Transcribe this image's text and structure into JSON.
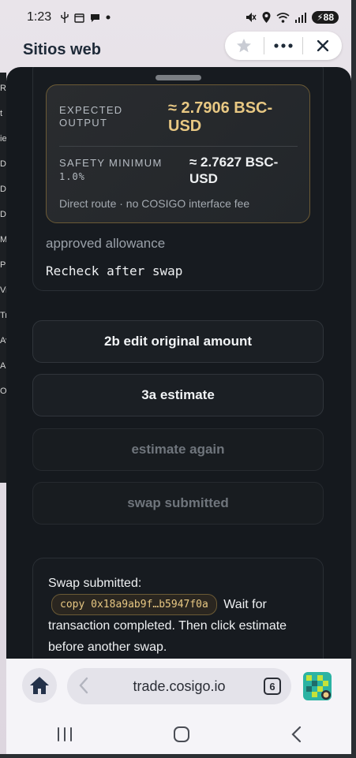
{
  "status_bar": {
    "time": "1:23",
    "battery": "88",
    "left_icons": [
      "usb-icon",
      "calendar-icon",
      "chat-icon",
      "dot-icon"
    ],
    "right_icons": [
      "mute-icon",
      "location-icon",
      "wifi-icon",
      "signal-icon"
    ]
  },
  "background_page": {
    "title": "Sitios web",
    "edge_letters": [
      "Re",
      "t",
      "ie",
      "Do",
      "Do",
      "Do",
      "M",
      "Pi",
      "Vi",
      "Tr",
      "Av",
      "A",
      "O"
    ]
  },
  "pill_actions": [
    "star-icon",
    "more-icon",
    "close-icon"
  ],
  "quote": {
    "expected_output_label": "EXPECTED OUTPUT",
    "expected_output_value": "≈ 2.7906 BSC-USD",
    "safety_minimum_label": "SAFETY MINIMUM",
    "safety_minimum_pct": "1.0%",
    "safety_minimum_value": "≈ 2.7627 BSC-USD",
    "route_note": "Direct route · no COSIGO interface fee",
    "accent_color": "#e8c883"
  },
  "allowance": {
    "label": "approved allowance",
    "value": "Recheck after swap"
  },
  "buttons": {
    "edit_amount": "2b edit original amount",
    "estimate": "3a estimate",
    "estimate_again": "estimate again",
    "swap_submitted": "swap submitted"
  },
  "notice": {
    "prefix": "Swap submitted:",
    "copy_chip": "copy 0x18a9ab9f…b5947f0a",
    "suffix": "Wait for transaction completed. Then click estimate before another swap."
  },
  "browser": {
    "url": "trade.cosigo.io",
    "tab_count": "6"
  },
  "nav": [
    "recent-apps-icon",
    "home-circle-icon",
    "back-icon"
  ]
}
